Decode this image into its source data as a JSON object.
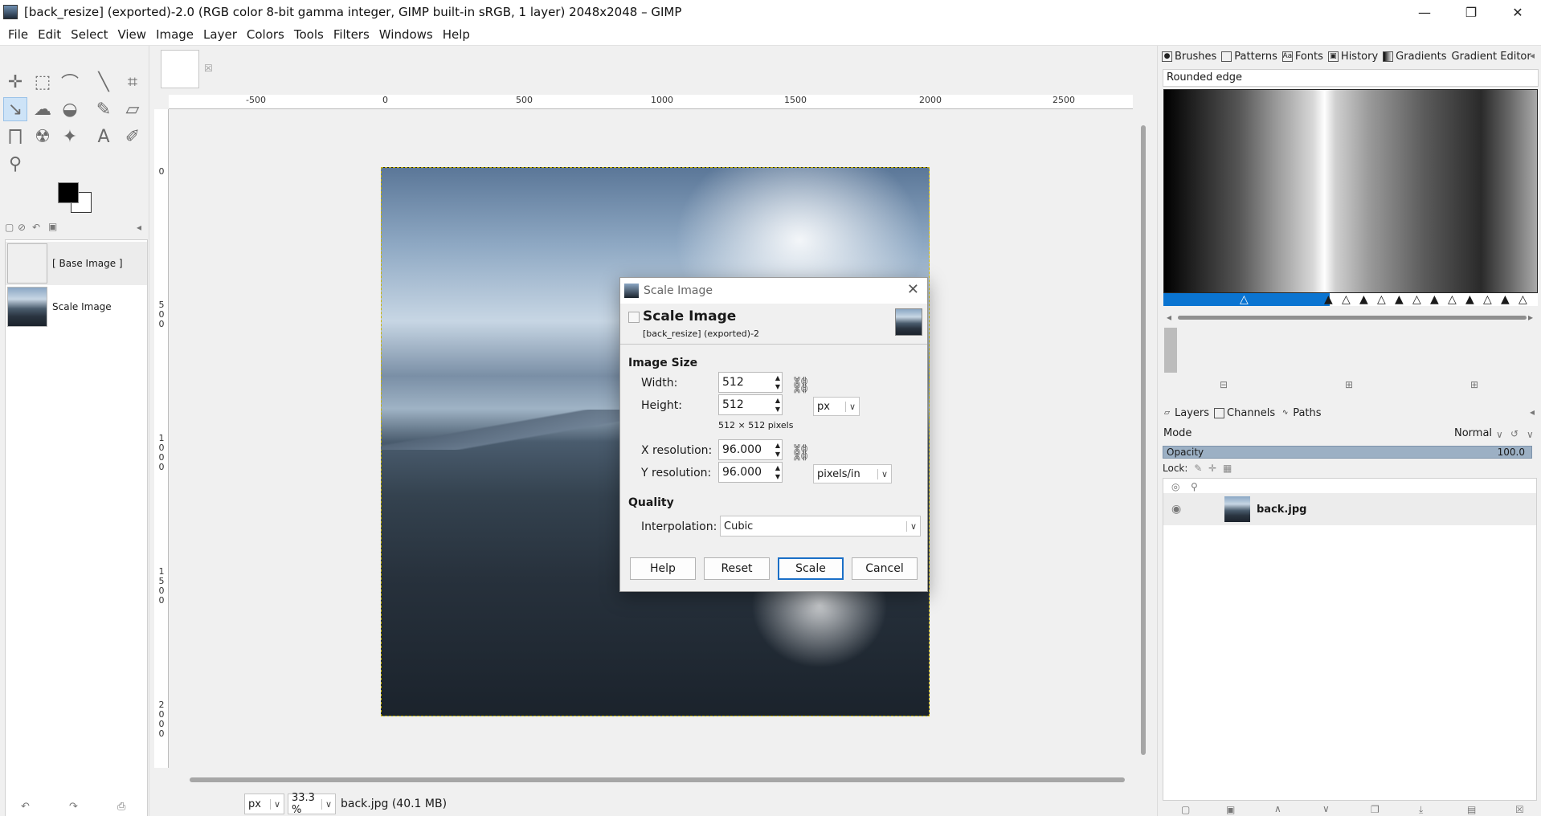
{
  "window": {
    "title": "[back_resize] (exported)-2.0 (RGB color 8-bit gamma integer, GIMP built-in sRGB, 1 layer) 2048x2048 – GIMP"
  },
  "menu": [
    "File",
    "Edit",
    "Select",
    "View",
    "Image",
    "Layer",
    "Colors",
    "Tools",
    "Filters",
    "Windows",
    "Help"
  ],
  "history": {
    "items": [
      {
        "label": "[ Base Image ]"
      },
      {
        "label": "Scale Image"
      }
    ]
  },
  "rulers": {
    "top": [
      "-500",
      "0",
      "500",
      "1000",
      "1500",
      "2000",
      "2500"
    ],
    "left": [
      "0",
      "500",
      "1000",
      "1500",
      "2000"
    ]
  },
  "statusbar": {
    "unit": "px",
    "zoom": "33.3 %",
    "file_info": "back.jpg (40.1 MB)"
  },
  "dock_top": {
    "tabs": [
      "Brushes",
      "Patterns",
      "Fonts",
      "History",
      "Gradients",
      "Gradient Editor"
    ],
    "gradient_name": "Rounded edge"
  },
  "dock_bottom": {
    "tabs": [
      "Layers",
      "Channels",
      "Paths"
    ],
    "mode_label": "Mode",
    "mode_value": "Normal",
    "opacity_label": "Opacity",
    "opacity_value": "100.0",
    "lock_label": "Lock:",
    "layer_name": "back.jpg"
  },
  "dialog": {
    "window_title": "Scale Image",
    "heading": "Scale Image",
    "subheading": "[back_resize] (exported)-2",
    "image_size_label": "Image Size",
    "width_label": "Width:",
    "width_value": "512",
    "height_label": "Height:",
    "height_value": "512",
    "size_unit": "px",
    "size_info": "512 × 512 pixels",
    "xres_label": "X resolution:",
    "xres_value": "96.000",
    "yres_label": "Y resolution:",
    "yres_value": "96.000",
    "res_unit": "pixels/in",
    "quality_label": "Quality",
    "interp_label": "Interpolation:",
    "interp_value": "Cubic",
    "buttons": {
      "help": "Help",
      "reset": "Reset",
      "scale": "Scale",
      "cancel": "Cancel"
    }
  }
}
